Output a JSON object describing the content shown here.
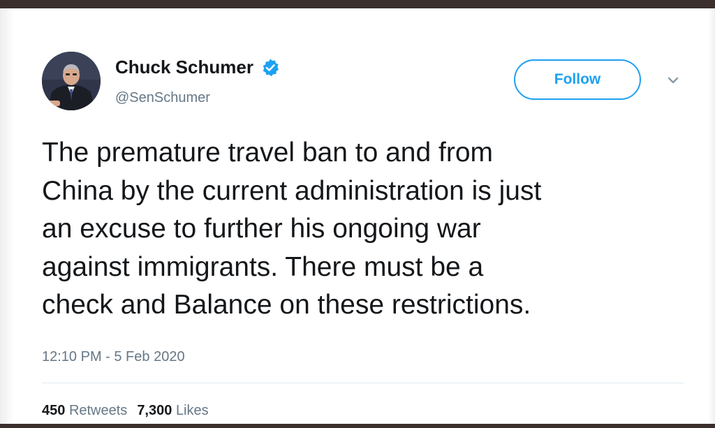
{
  "tweet": {
    "author": {
      "display_name": "Chuck Schumer",
      "handle": "@SenSchumer",
      "verified": true
    },
    "follow_label": "Follow",
    "text_lines": [
      "The premature travel ban to and from",
      "China by the current administration is just",
      "an excuse to further his ongoing war",
      "against immigrants. There must be a",
      "check and Balance on these restrictions."
    ],
    "timestamp": "12:10 PM - 5 Feb 2020",
    "stats": {
      "retweets_count": "450",
      "retweets_label": "Retweets",
      "likes_count": "7,300",
      "likes_label": "Likes"
    }
  },
  "icons": {
    "verified": "verified-badge-icon",
    "menu": "chevron-down-icon"
  },
  "colors": {
    "accent": "#1da1f2",
    "text": "#14171a",
    "muted": "#657786",
    "frame": "#3a2f2c"
  }
}
